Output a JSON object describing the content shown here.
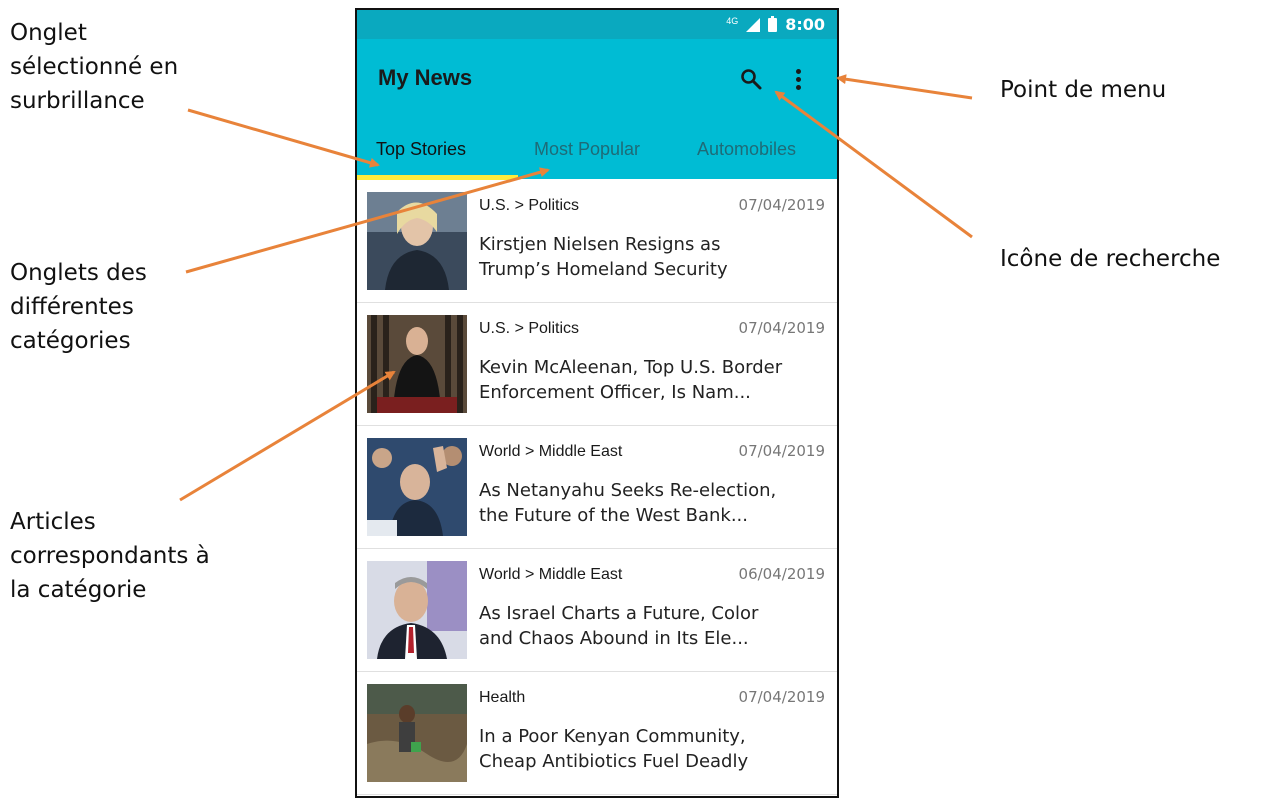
{
  "annotations": {
    "selected_tab": [
      "Onglet",
      "sélectionné en",
      "surbrillance"
    ],
    "tabs_categories": [
      "Onglets des",
      "différentes",
      "catégories"
    ],
    "articles": [
      "Articles",
      "correspondants à",
      "la catégorie"
    ],
    "menu_point": "Point de menu",
    "search_icon": "Icône de recherche"
  },
  "statusbar": {
    "network": "4G",
    "time": "8:00"
  },
  "app": {
    "title": "My News"
  },
  "tabs": [
    {
      "label": "Top Stories",
      "selected": true
    },
    {
      "label": "Most Popular",
      "selected": false
    },
    {
      "label": "Automobiles",
      "selected": false
    }
  ],
  "articles": [
    {
      "category": "U.S. > Politics",
      "date": "07/04/2019",
      "headline_line1": "Kirstjen Nielsen Resigns as",
      "headline_line2": "Trump’s Homeland Security"
    },
    {
      "category": "U.S. > Politics",
      "date": "07/04/2019",
      "headline_line1": "Kevin McAleenan, Top U.S. Border",
      "headline_line2": "Enforcement Officer, Is Nam..."
    },
    {
      "category": "World > Middle East",
      "date": "07/04/2019",
      "headline_line1": "As Netanyahu Seeks Re-election,",
      "headline_line2": "the Future of the West Bank..."
    },
    {
      "category": "World > Middle East",
      "date": "06/04/2019",
      "headline_line1": "As Israel Charts a Future, Color",
      "headline_line2": "and Chaos Abound in Its Ele..."
    },
    {
      "category": "Health",
      "date": "07/04/2019",
      "headline_line1": "In a Poor Kenyan Community,",
      "headline_line2": "Cheap Antibiotics Fuel Deadly"
    }
  ],
  "colors": {
    "appbar": "#00bcd4",
    "statusbar": "#0aa9bf",
    "indicator": "#ffeb3b",
    "arrow": "#e8833a"
  }
}
